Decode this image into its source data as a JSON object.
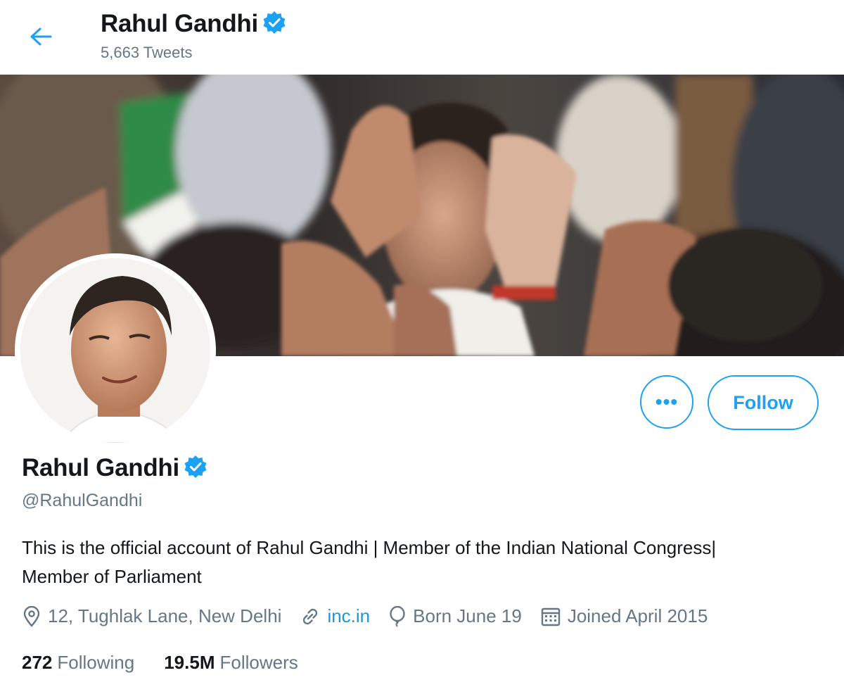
{
  "header": {
    "name": "Rahul Gandhi",
    "tweet_count": "5,663 Tweets"
  },
  "actions": {
    "more_label": "•••",
    "follow_label": "Follow"
  },
  "profile": {
    "name": "Rahul Gandhi",
    "handle": "@RahulGandhi",
    "bio": "This is the official account of Rahul Gandhi | Member of the Indian National Congress| Member of Parliament",
    "location": "12, Tughlak Lane, New Delhi",
    "website": "inc.in",
    "birthday": "Born June 19",
    "joined": "Joined April 2015"
  },
  "stats": {
    "following_count": "272",
    "following_label": "Following",
    "followers_count": "19.5M",
    "followers_label": "Followers"
  },
  "icons": {
    "back": "arrow-left-icon",
    "verified": "verified-badge-icon",
    "location": "location-pin-icon",
    "link": "link-icon",
    "birthday": "balloon-icon",
    "joined": "calendar-icon"
  },
  "colors": {
    "accent": "#1da1f2",
    "link": "#1b95e0",
    "muted_text": "#657786",
    "text": "#14171a"
  }
}
